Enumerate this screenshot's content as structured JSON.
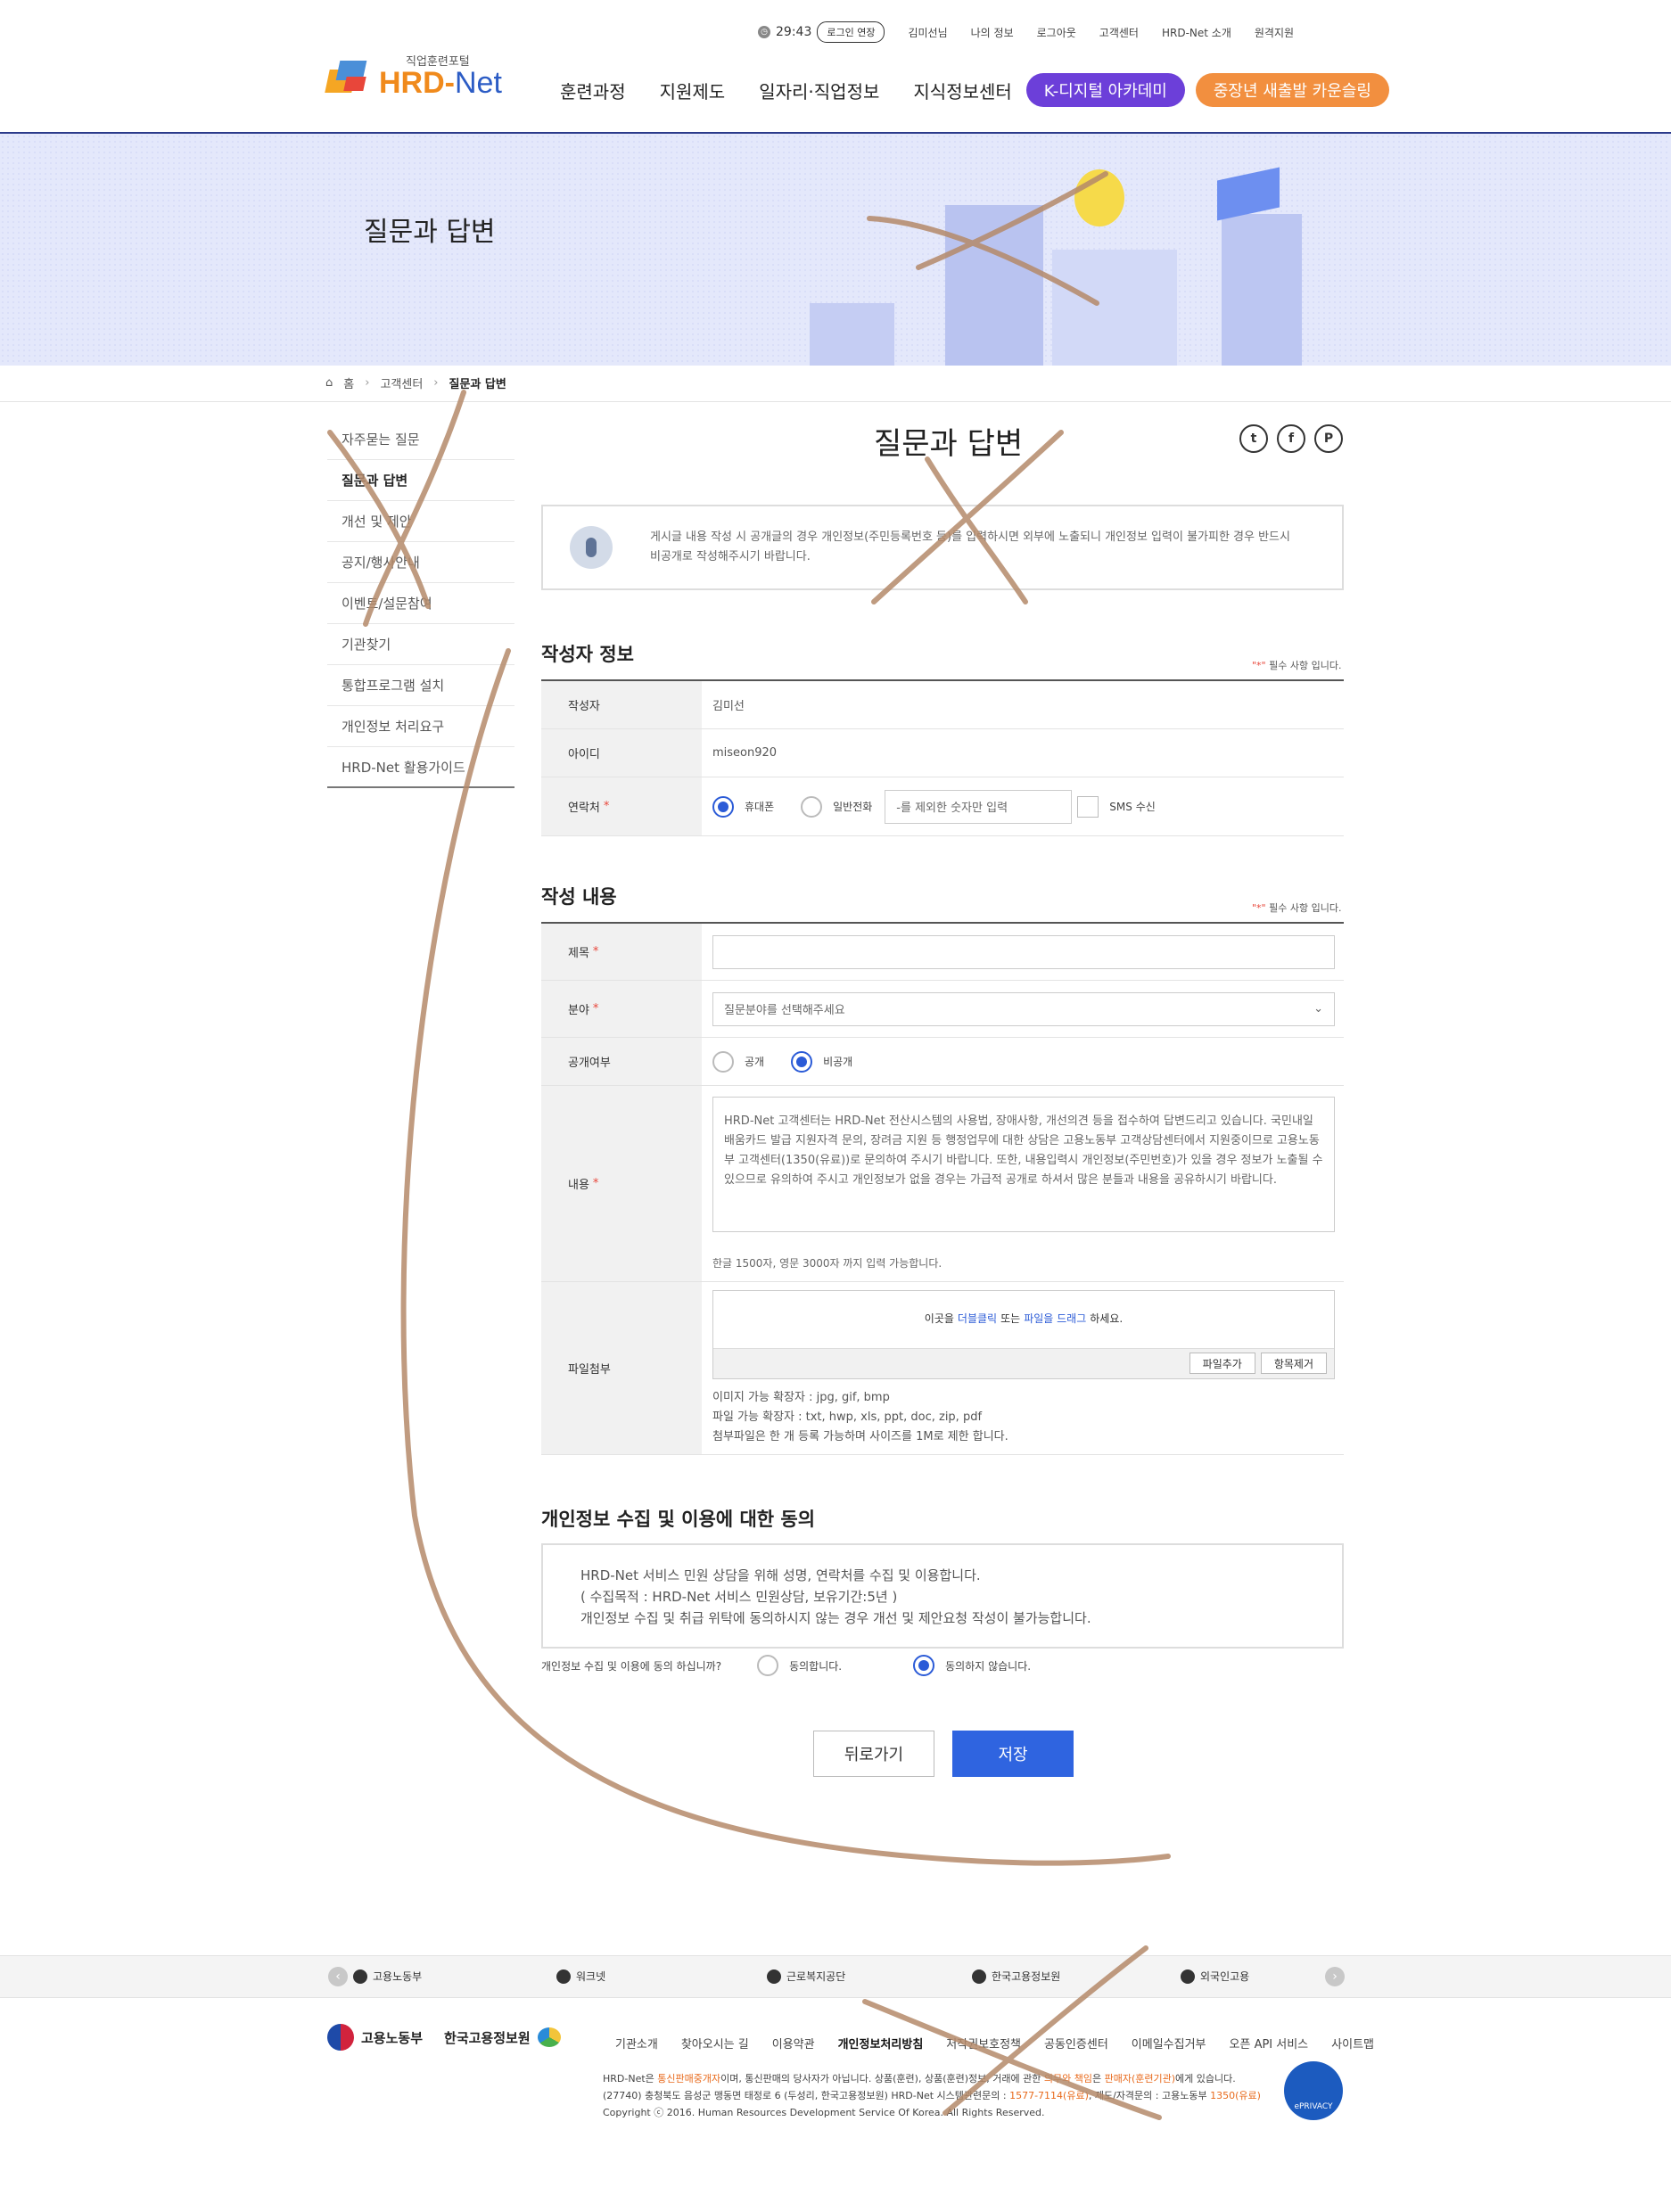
{
  "utility": {
    "timer": "29:43",
    "extend_label": "로그인 연장",
    "links": [
      "김미선님",
      "나의 정보",
      "로그아웃",
      "고객센터",
      "HRD-Net 소개",
      "원격지원"
    ]
  },
  "logo": {
    "sub": "직업훈련포털",
    "main_hrd": "HRD-",
    "main_net": "Net"
  },
  "gnb": {
    "items": [
      "훈련과정",
      "지원제도",
      "일자리·직업정보",
      "지식정보센터"
    ],
    "pill_digital": "K-디지털 아카데미",
    "pill_counsel": "중장년 새출발 카운슬링"
  },
  "hero": {
    "title": "질문과 답변"
  },
  "breadcrumb": {
    "home": "홈",
    "level1": "고객센터",
    "current": "질문과 답변"
  },
  "lnb": [
    "자주묻는 질문",
    "질문과 답변",
    "개선 및 제안",
    "공지/행사안내",
    "이벤트/설문참여",
    "기관찾기",
    "통합프로그램 설치",
    "개인정보 처리요구",
    "HRD-Net 활용가이드"
  ],
  "page_title": "질문과 답변",
  "share": {
    "twitter": "t",
    "facebook": "f",
    "print": "P"
  },
  "notice": "게시글 내용 작성 시 공개글의 경우 개인정보(주민등록번호 등)를 입력하시면 외부에 노출되니 개인정보 입력이 불가피한 경우 반드시 비공개로 작성해주시기 바랍니다.",
  "writer": {
    "title": "작성자 정보",
    "required_note_star": "\"*\"",
    "required_note": " 필수 사항 입니다.",
    "label_name": "작성자",
    "name": "김미선",
    "label_id": "아이디",
    "id": "miseon920",
    "label_contact": "연락처",
    "opt_mobile": "휴대폰",
    "opt_phone": "일반전화",
    "phone_placeholder": "-를 제외한 숫자만 입력",
    "sms": "SMS 수신"
  },
  "content": {
    "title": "작성 내용",
    "label_subject": "제목",
    "label_category": "분야",
    "category_value": "질문분야를 선택해주세요",
    "label_public": "공개여부",
    "opt_public": "공개",
    "opt_private": "비공개",
    "label_body": "내용",
    "body_placeholder": "HRD-Net 고객센터는 HRD-Net 전산시스템의 사용법, 장애사항, 개선의견 등을 접수하여 답변드리고 있습니다. 국민내일배움카드 발급 지원자격 문의, 장려금 지원 등 행정업무에 대한 상담은 고용노동부 고객상담센터에서 지원중이므로 고용노동부 고객센터(1350(유료))로 문의하여 주시기 바랍니다. 또한, 내용입력시 개인정보(주민번호)가 있을 경우 정보가 노출될 수 있으므로 유의하여 주시고 개인정보가 없을 경우는 가급적 공개로 하셔서 많은 분들과 내용을 공유하시기 바랍니다.",
    "limit": "한글 1500자, 영문 3000자 까지 입력 가능합니다.",
    "label_file": "파일첨부",
    "drop_1": "이곳을",
    "drop_2": "더블클릭",
    "drop_3": "또는",
    "drop_4": "파일을 드래그",
    "drop_5": "하세요.",
    "btn_add": "파일추가",
    "btn_remove": "항목제거",
    "file_info_1": "이미지 가능 확장자 : jpg, gif, bmp",
    "file_info_2": "파일 가능 확장자 : txt, hwp, xls, ppt, doc, zip, pdf",
    "file_info_3": "첨부파일은 한 개 등록 가능하며 사이즈를 1M로 제한 합니다."
  },
  "consent": {
    "title": "개인정보 수집 및 이용에 대한 동의",
    "line1": "HRD-Net 서비스 민원 상담을 위해 성명, 연락처를 수집 및 이용합니다.",
    "line2": "( 수집목적 : HRD-Net 서비스 민원상담, 보유기간:5년 )",
    "line3": "개인정보 수집 및 취급 위탁에 동의하시지 않는 경우 개선 및 제안요청 작성이 불가능합니다.",
    "question": "개인정보 수집 및 이용에 동의 하십니까?",
    "agree": "동의합니다.",
    "disagree": "동의하지 않습니다."
  },
  "buttons": {
    "back": "뒤로가기",
    "save": "저장"
  },
  "footer": {
    "orgs": [
      "고용노동부",
      "워크넷",
      "근로복지공단",
      "한국고용정보원",
      "외국인고용"
    ],
    "logo1": "고용노동부",
    "logo2": "한국고용정보원",
    "menu": [
      "기관소개",
      "찾아오시는 길",
      "이용약관",
      "개인정보처리방침",
      "저작권보호정책",
      "공동인증센터",
      "이메일수집거부",
      "오픈 API 서비스",
      "사이트맵"
    ],
    "info1_a": "HRD-Net은 ",
    "info1_b": "통신판매중개자",
    "info1_c": "이며, 통신판매의 당사자가 아닙니다. 상품(훈련), 상품(훈련)정보, 거래에 관한 ",
    "info1_d": "의무와 책임",
    "info1_e": "은 ",
    "info1_f": "판매자(훈련기관)",
    "info1_g": "에게 있습니다.",
    "info2_a": "(27740) 충청북도 음성군 맹동면 태정로 6 (두성리, 한국고용정보원) HRD-Net 시스템관련문의 : ",
    "info2_b": "1577-7114(유료)",
    "info2_c": ", 제도/자격문의 : 고용노동부 ",
    "info2_d": "1350(유료)",
    "info3": "Copyright ⓒ 2016. Human Resources Development Service Of Korea. All Rights Reserved.",
    "badge": "ePRIVACY"
  },
  "colors": {
    "accent": "#2f64e0",
    "purple_pill": "#6c3fd9",
    "orange_pill": "#f28f3f",
    "required": "#e8463a",
    "scribble": "#b58a6a"
  }
}
